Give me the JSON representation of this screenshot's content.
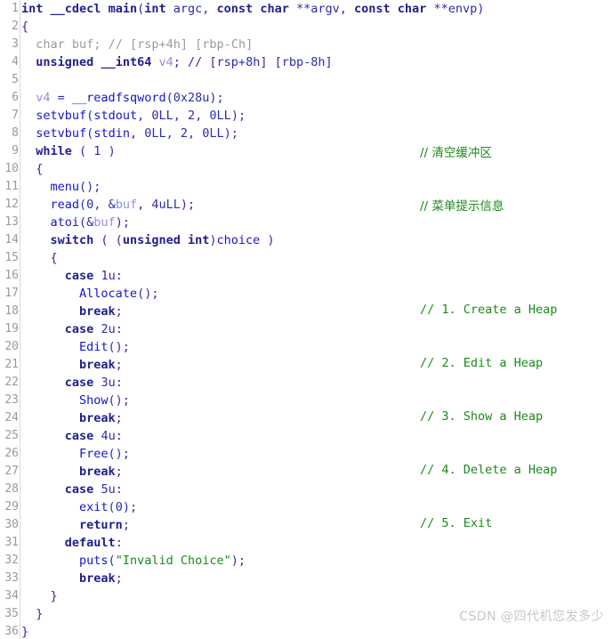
{
  "editor": {
    "kind": "decompiler-pseudocode-view",
    "language": "C",
    "first_line": 1,
    "last_line": 36,
    "total_lines": 36,
    "gutter_numbers": [
      "1",
      "2",
      "3",
      "4",
      "5",
      "6",
      "7",
      "8",
      "9",
      "10",
      "11",
      "12",
      "13",
      "14",
      "15",
      "16",
      "17",
      "18",
      "19",
      "20",
      "21",
      "22",
      "23",
      "24",
      "25",
      "26",
      "27",
      "28",
      "29",
      "30",
      "31",
      "32",
      "33",
      "34",
      "35",
      "36"
    ],
    "colors": {
      "background": "#ffffff",
      "gutter_text": "#9a9a9a",
      "gutter_divider": "#d9d9d9",
      "keyword": "#202090",
      "function": "#1414d2",
      "local_variable": "#8f8fe0",
      "dimmed": "#9a9a9a",
      "comment": "#1a8a1a",
      "string": "#1a8a1a",
      "register_hint": "#a0a0e8",
      "watermark": "#c8c8c8"
    }
  },
  "code": {
    "lines": [
      {
        "n": "1",
        "text": "int __cdecl main(int argc, const char **argv, const char **envp)"
      },
      {
        "n": "2",
        "text": "{"
      },
      {
        "n": "3",
        "text": "  char buf; // [rsp+4h] [rbp-Ch]"
      },
      {
        "n": "4",
        "text": "  unsigned __int64 v4; // [rsp+8h] [rbp-8h]"
      },
      {
        "n": "5",
        "text": ""
      },
      {
        "n": "6",
        "text": "  v4 = __readfsqword(0x28u);"
      },
      {
        "n": "7",
        "text": "  setvbuf(stdout, 0LL, 2, 0LL);"
      },
      {
        "n": "8",
        "text": "  setvbuf(stdin, 0LL, 2, 0LL);",
        "tail": "// 清空缓冲区"
      },
      {
        "n": "9",
        "text": "  while ( 1 )"
      },
      {
        "n": "10",
        "text": "  {"
      },
      {
        "n": "11",
        "text": "    menu();",
        "tail": "// 菜单提示信息"
      },
      {
        "n": "12",
        "text": "    read(0, &buf, 4uLL);"
      },
      {
        "n": "13",
        "text": "    atoi(&buf);"
      },
      {
        "n": "14",
        "text": "    switch ( (unsigned int)choice )"
      },
      {
        "n": "15",
        "text": "    {"
      },
      {
        "n": "16",
        "text": "      case 1u:"
      },
      {
        "n": "17",
        "text": "        Allocate();",
        "tail": "// 1. Create a Heap"
      },
      {
        "n": "18",
        "text": "        break;"
      },
      {
        "n": "19",
        "text": "      case 2u:"
      },
      {
        "n": "20",
        "text": "        Edit();",
        "tail": "// 2. Edit a Heap"
      },
      {
        "n": "21",
        "text": "        break;"
      },
      {
        "n": "22",
        "text": "      case 3u:"
      },
      {
        "n": "23",
        "text": "        Show();",
        "tail": "// 3. Show a Heap"
      },
      {
        "n": "24",
        "text": "        break;"
      },
      {
        "n": "25",
        "text": "      case 4u:"
      },
      {
        "n": "26",
        "text": "        Free();",
        "tail": "// 4. Delete a Heap"
      },
      {
        "n": "27",
        "text": "        break;"
      },
      {
        "n": "28",
        "text": "      case 5u:"
      },
      {
        "n": "29",
        "text": "        exit(0);",
        "tail": "// 5. Exit"
      },
      {
        "n": "30",
        "text": "        return;"
      },
      {
        "n": "31",
        "text": "      default:"
      },
      {
        "n": "32",
        "text": "        puts(\"Invalid Choice\");"
      },
      {
        "n": "33",
        "text": "        break;"
      },
      {
        "n": "34",
        "text": "    }"
      },
      {
        "n": "35",
        "text": "  }"
      },
      {
        "n": "36",
        "text": "}"
      }
    ],
    "tail_comments": [
      {
        "line": "8",
        "text": "// 清空缓冲区",
        "cjk": true
      },
      {
        "line": "11",
        "text": "// 菜单提示信息",
        "cjk": true
      },
      {
        "line": "17",
        "text": "// 1. Create a Heap",
        "cjk": false
      },
      {
        "line": "20",
        "text": "// 2. Edit a Heap",
        "cjk": false
      },
      {
        "line": "23",
        "text": "// 3. Show a Heap",
        "cjk": false
      },
      {
        "line": "26",
        "text": "// 4. Delete a Heap",
        "cjk": false
      },
      {
        "line": "29",
        "text": "// 5. Exit",
        "cjk": false
      }
    ],
    "function_signature": {
      "return_type": "int",
      "calling_convention": "__cdecl",
      "name": "main",
      "parameters": [
        "int argc",
        "const char **argv",
        "const char **envp"
      ]
    },
    "declarations": [
      {
        "type": "char",
        "name": "buf",
        "stack_comment": "// [rsp+4h] [rbp-Ch]",
        "unused": true
      },
      {
        "type": "unsigned __int64",
        "name": "v4",
        "stack_comment": "// [rsp+8h] [rbp-8h]",
        "unused": false
      }
    ],
    "string_literals": [
      "\"Invalid Choice\""
    ],
    "called_functions": [
      "__readfsqword",
      "setvbuf",
      "menu",
      "read",
      "atoi",
      "Allocate",
      "Edit",
      "Show",
      "Free",
      "exit",
      "puts"
    ],
    "switch_cases": [
      "case 1u:",
      "case 2u:",
      "case 3u:",
      "case 4u:",
      "case 5u:",
      "default:"
    ]
  },
  "watermark": {
    "text": "CSDN @四代机您发多少"
  }
}
